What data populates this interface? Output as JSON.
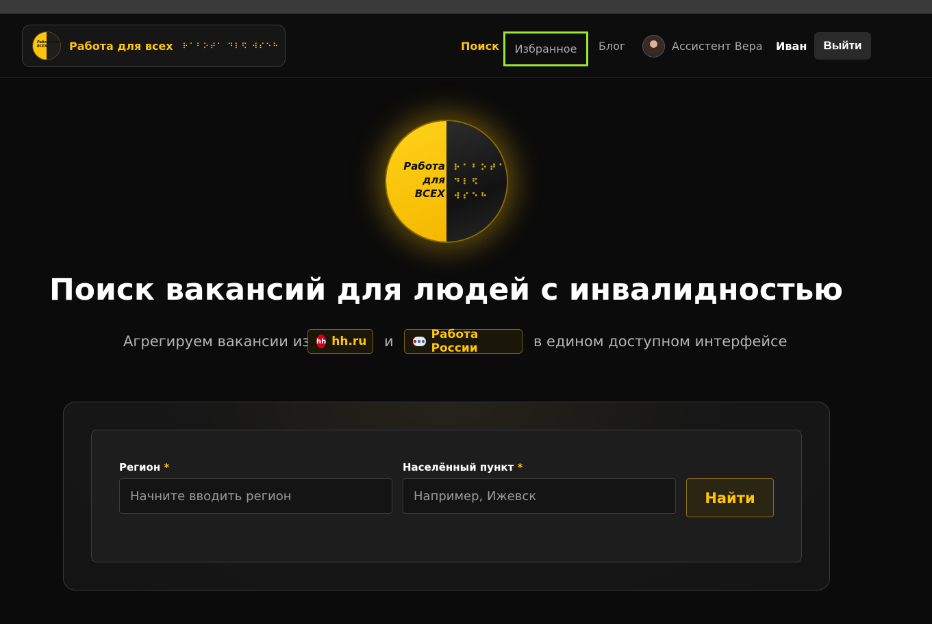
{
  "brand": {
    "name": "Работа для всех",
    "braille": "⠗⠁⠃⠕⠞⠁ ⠙⠇⠫ ⠺⠎⠑⠓",
    "mini_logo_text": "Работа для ВСЕХ"
  },
  "nav": {
    "search": "Поиск",
    "favorites": "Избранное",
    "blog": "Блог",
    "assistant": "Ассистент Вера",
    "user": "Иван",
    "logout": "Выйти"
  },
  "hero": {
    "logo_text_1": "Работа",
    "logo_text_2": "для",
    "logo_text_3": "ВСЕХ",
    "braille_1": "⠗⠁⠃⠕⠞⠁",
    "braille_2": "⠙⠇⠫",
    "braille_3": "⠺⠎⠑⠓",
    "title": "Поиск вакансий для людей с инвалидностью",
    "subtitle_pre": "Агрегируем вакансии из",
    "source_1": "hh.ru",
    "source_1_icon": "hh",
    "subtitle_and": "и",
    "source_2": "Работа России",
    "subtitle_post": "в едином доступном интерфейсе"
  },
  "search_form": {
    "region_label": "Регион",
    "region_placeholder": "Начните вводить регион",
    "city_label": "Населённый пункт",
    "city_placeholder": "Например, Ижевск",
    "required_mark": "*",
    "submit": "Найти"
  },
  "colors": {
    "accent": "#ffc40c",
    "focus_ring": "#9be62e",
    "background": "#0b0b0b"
  }
}
